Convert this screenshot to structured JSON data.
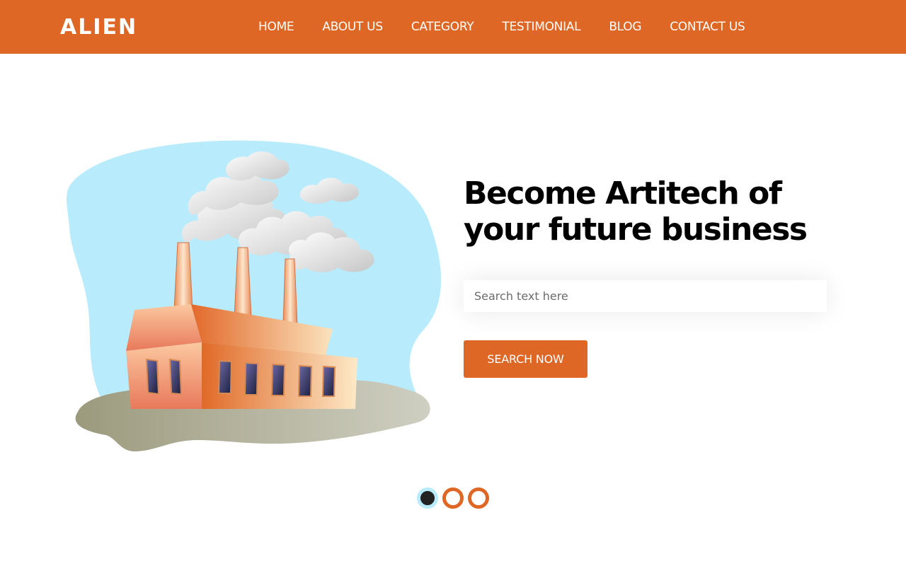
{
  "header": {
    "logo": "ALIEN",
    "nav": [
      {
        "label": "HOME"
      },
      {
        "label": "ABOUT US"
      },
      {
        "label": "CATEGORY"
      },
      {
        "label": "TESTIMONIAL"
      },
      {
        "label": "BLOG"
      },
      {
        "label": "CONTACT US"
      }
    ]
  },
  "hero": {
    "title": "Become Artitech of your future business",
    "search_placeholder": "Search text here",
    "search_button": "SEARCH NOW"
  },
  "carousel": {
    "slides": 3,
    "active_index": 0
  },
  "colors": {
    "brand": "#df6726",
    "sky": "#b8ecfc",
    "ground": "#a9a98f"
  },
  "illustration": {
    "icon": "factory-illustration"
  }
}
